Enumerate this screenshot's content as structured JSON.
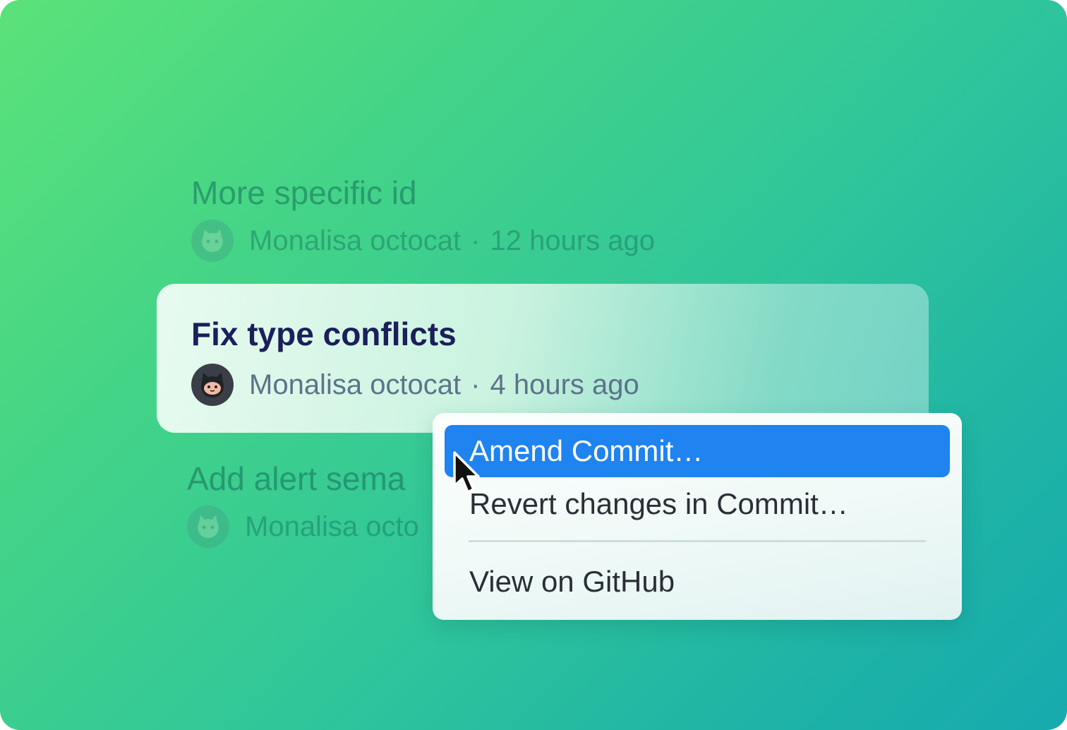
{
  "commits": [
    {
      "title": "More specific id",
      "author": "Monalisa octocat",
      "separator": "·",
      "time": "12 hours ago",
      "avatar_icon": "octocat-avatar-faded"
    },
    {
      "title": "Fix type conflicts",
      "author": "Monalisa octocat",
      "separator": "·",
      "time": "4 hours ago",
      "avatar_icon": "octocat-avatar"
    },
    {
      "title": "Add alert sema",
      "author": "Monalisa octo",
      "separator": "",
      "time": "",
      "avatar_icon": "octocat-avatar-faded"
    }
  ],
  "context_menu": {
    "items": [
      {
        "label": "Amend Commit…",
        "highlighted": true
      },
      {
        "label": "Revert changes in Commit…",
        "highlighted": false
      },
      {
        "label": "View on GitHub",
        "highlighted": false
      }
    ]
  },
  "colors": {
    "background_start": "#5be279",
    "background_end": "#17aaaf",
    "selected_title": "#1b1f5a",
    "menu_highlight": "#1f83f0"
  },
  "cursor_icon": "arrow-pointer-icon"
}
